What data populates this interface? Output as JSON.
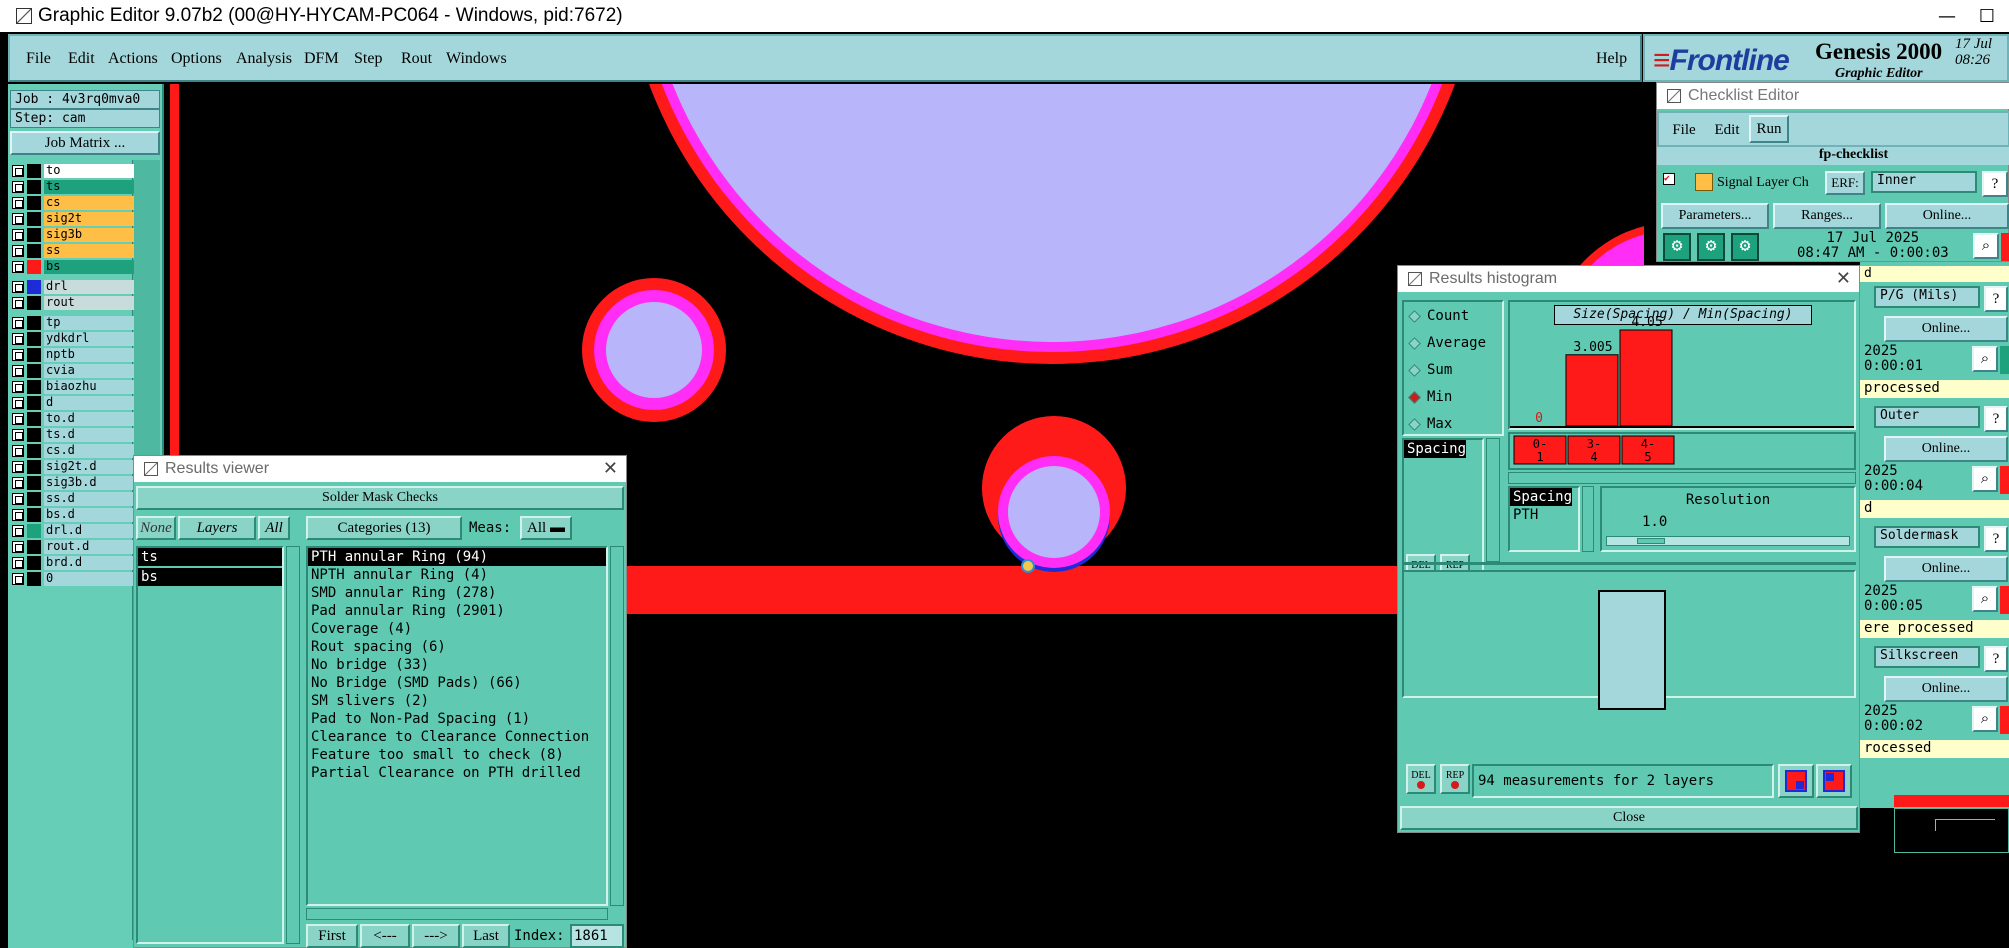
{
  "window": {
    "title": "Graphic Editor 9.07b2 (00@HY-HYCAM-PC064 - Windows, pid:7672)",
    "min": "—",
    "max": "☐"
  },
  "menu": {
    "items": [
      "File",
      "Edit",
      "Actions",
      "Options",
      "Analysis",
      "DFM",
      "Step",
      "Rout",
      "Windows"
    ],
    "help": "Help"
  },
  "brand": {
    "logo_a": "≡",
    "logo_b": "Frontline",
    "product": "Genesis 2000",
    "subtitle": "Graphic Editor",
    "date1": "17 Jul",
    "date2": "08:26"
  },
  "left": {
    "job": "Job : 4v3rq0mva0",
    "step": "Step: cam",
    "job_matrix": "Job Matrix ...",
    "layers": [
      {
        "name": "to",
        "color": "#ffffff",
        "sw": "#000000"
      },
      {
        "name": "ts",
        "color": "#1ea27e",
        "sw": "#000000"
      },
      {
        "name": "cs",
        "color": "#ffbf47",
        "sw": "#000000"
      },
      {
        "name": "sig2t",
        "color": "#ffbf47",
        "sw": "#000000"
      },
      {
        "name": "sig3b",
        "color": "#ffbf47",
        "sw": "#000000"
      },
      {
        "name": "ss",
        "color": "#ffbf47",
        "sw": "#000000"
      },
      {
        "name": "bs",
        "color": "#1ea27e",
        "sw": "#ff1a1a"
      }
    ],
    "drill_layers": [
      {
        "name": "drl",
        "sw": "#1f2bd6"
      },
      {
        "name": "rout",
        "sw": "#000000"
      }
    ],
    "misc_layers": [
      "tp",
      "ydkdrl",
      "nptb",
      "cvia",
      "biaozhu",
      "d",
      "to.d",
      "ts.d",
      "cs.d",
      "sig2t.d",
      "sig3b.d",
      "ss.d",
      "bs.d",
      "drl.d",
      "rout.d",
      "brd.d",
      "0"
    ]
  },
  "results_viewer": {
    "title": "Results viewer",
    "header": "Solder Mask Checks",
    "none": "None",
    "layers": "Layers",
    "all": "All",
    "categories": "Categories (13)",
    "meas_label": "Meas:",
    "meas_value": "All",
    "layer_items": [
      "ts",
      "bs"
    ],
    "category_items": [
      "PTH annular Ring (94)",
      "NPTH annular Ring (4)",
      "SMD annular Ring (278)",
      "Pad annular Ring (2901)",
      "Coverage (4)",
      "Rout spacing (6)",
      "No bridge (33)",
      "No Bridge (SMD Pads) (66)",
      "SM slivers (2)",
      "Pad to Non-Pad Spacing (1)",
      "Clearance to Clearance Connection",
      "Feature too small to check (8)",
      "Partial Clearance on PTH drilled"
    ],
    "first": "First",
    "prev": "<---",
    "next": "--->",
    "last": "Last",
    "index_label": "Index:",
    "index_value": "1861"
  },
  "histogram": {
    "title": "Results histogram",
    "options": [
      "Count",
      "Average",
      "Sum",
      "Min",
      "Max"
    ],
    "selected": "Min",
    "list_item": "Spacing",
    "del": "DEL",
    "rep": "REP",
    "chart_title": "Size(Spacing) / Min(Spacing)",
    "bucket_labels": [
      "0-\n1",
      "3-\n4",
      "4-\n5"
    ],
    "lower_left": [
      "Spacing",
      "PTH"
    ],
    "resolution_label": "Resolution",
    "resolution_value": "1.0",
    "status": "94 measurements for 2 layers",
    "close": "Close"
  },
  "chart_data": {
    "type": "bar",
    "title": "Size(Spacing) / Min(Spacing)",
    "categories": [
      "0-1",
      "3-4",
      "4-5"
    ],
    "values": [
      0,
      3.005,
      4.05
    ],
    "value_labels": [
      "0",
      "3.005",
      "4.05"
    ]
  },
  "checklist": {
    "title": "Checklist Editor",
    "menu": [
      "File",
      "Edit",
      "Run"
    ],
    "name": "fp-checklist",
    "row1": "Signal Layer Ch",
    "erf": "ERF:",
    "erf_val": "Inner",
    "params": "Parameters...",
    "ranges": "Ranges...",
    "online": "Online...",
    "date_line1": "17 Jul 2025",
    "date_line2": "08:47 AM - 0:00:03",
    "side_rows": [
      {
        "field": "P/G (Mils)",
        "y1": "2025",
        "y2": "0:00:01",
        "note": " processed"
      },
      {
        "field": "Outer",
        "y1": "2025",
        "y2": "0:00:04",
        "note": "d"
      },
      {
        "field": "Soldermask",
        "y1": "2025",
        "y2": "0:00:05",
        "note": "ere processed"
      },
      {
        "field": "Silkscreen",
        "y1": "2025",
        "y2": "0:00:02",
        "note": "rocessed"
      }
    ],
    "d_note": "d",
    "q": "?"
  }
}
